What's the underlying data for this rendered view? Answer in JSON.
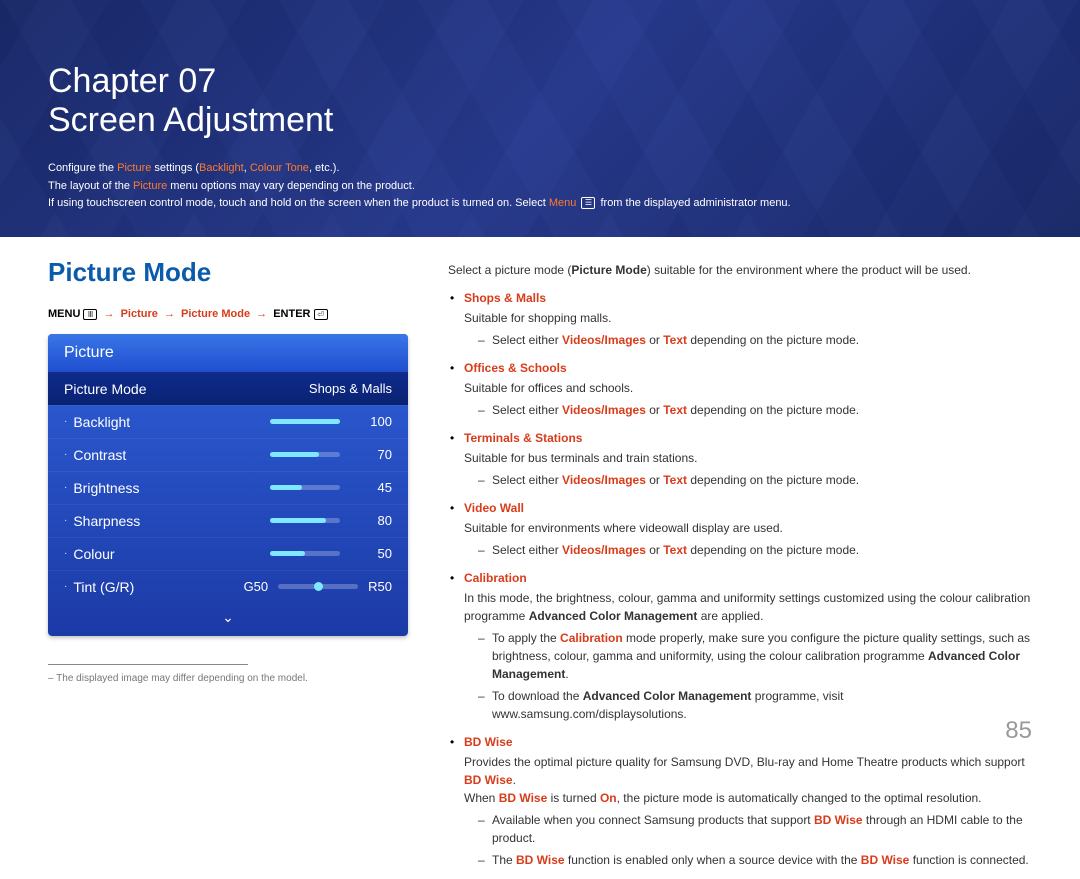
{
  "chapter": {
    "label": "Chapter",
    "num": "07",
    "title": "Screen Adjustment"
  },
  "banner": {
    "line1_a": "Configure the ",
    "line1_b": "Picture",
    "line1_c": " settings (",
    "line1_d": "Backlight",
    "line1_e": ", ",
    "line1_f": "Colour Tone",
    "line1_g": ", etc.).",
    "line2_a": "The layout of the ",
    "line2_b": "Picture",
    "line2_c": " menu options may vary depending on the product.",
    "line3_a": "If using touchscreen control mode, touch and hold on the screen when the product is turned on. Select ",
    "line3_b": "Menu",
    "line3_c": " from the displayed administrator menu."
  },
  "section_title": "Picture Mode",
  "path": {
    "menu": "MENU",
    "p1": "Picture",
    "p2": "Picture Mode",
    "enter": "ENTER",
    "arrow": "→"
  },
  "osd": {
    "header": "Picture",
    "mode_label": "Picture Mode",
    "mode_value": "Shops & Malls",
    "items": [
      {
        "label": "Backlight",
        "value": "100",
        "pct": 100
      },
      {
        "label": "Contrast",
        "value": "70",
        "pct": 70
      },
      {
        "label": "Brightness",
        "value": "45",
        "pct": 45
      },
      {
        "label": "Sharpness",
        "value": "80",
        "pct": 80
      },
      {
        "label": "Colour",
        "value": "50",
        "pct": 50
      }
    ],
    "tint": {
      "label": "Tint (G/R)",
      "g": "G50",
      "r": "R50",
      "pos": 50
    },
    "more": "⌄"
  },
  "footnote": "The displayed image may differ depending on the model.",
  "lead_a": "Select a picture mode (",
  "lead_b": "Picture Mode",
  "lead_c": ") suitable for the environment where the product will be used.",
  "select_phrase_a": "Select either ",
  "select_phrase_b": "Videos/Images",
  "select_phrase_c": " or ",
  "select_phrase_d": "Text",
  "select_phrase_e": " depending on the picture mode.",
  "modes": {
    "shops": {
      "name": "Shops & Malls",
      "desc": "Suitable for shopping malls."
    },
    "offices": {
      "name": "Offices & Schools",
      "desc": "Suitable for offices and schools."
    },
    "terminals": {
      "name": "Terminals & Stations",
      "desc": "Suitable for bus terminals and train stations."
    },
    "videowall": {
      "name": "Video Wall",
      "desc": "Suitable for environments where videowall display are used."
    },
    "calib": {
      "name": "Calibration",
      "desc1_a": "In this mode, the brightness, colour, gamma and uniformity settings customized using the colour calibration programme ",
      "desc1_b": "Advanced Color Management",
      "desc1_c": " are applied.",
      "sub1_a": "To apply the ",
      "sub1_b": "Calibration",
      "sub1_c": " mode properly, make sure you configure the picture quality settings, such as brightness, colour, gamma and uniformity, using the colour calibration programme ",
      "sub1_d": "Advanced Color Management",
      "sub1_e": ".",
      "sub2_a": "To download the ",
      "sub2_b": "Advanced Color Management",
      "sub2_c": " programme, visit www.samsung.com/displaysolutions."
    },
    "bdwise": {
      "name": "BD Wise",
      "desc_a": "Provides the optimal picture quality for Samsung DVD, Blu-ray and Home Theatre products which support ",
      "desc_b": "BD Wise",
      "desc_c": ".",
      "desc_d": "When ",
      "desc_e": "BD Wise",
      "desc_f": " is turned ",
      "desc_g": "On",
      "desc_h": ", the picture mode is automatically changed to the optimal resolution.",
      "sub1_a": "Available when you connect Samsung products that support ",
      "sub1_b": "BD Wise",
      "sub1_c": " through an HDMI cable to the product.",
      "sub2_a": "The ",
      "sub2_b": "BD Wise",
      "sub2_c": " function is enabled only when a source device with the ",
      "sub2_d": "BD Wise",
      "sub2_e": " function is connected."
    }
  },
  "page": "85"
}
